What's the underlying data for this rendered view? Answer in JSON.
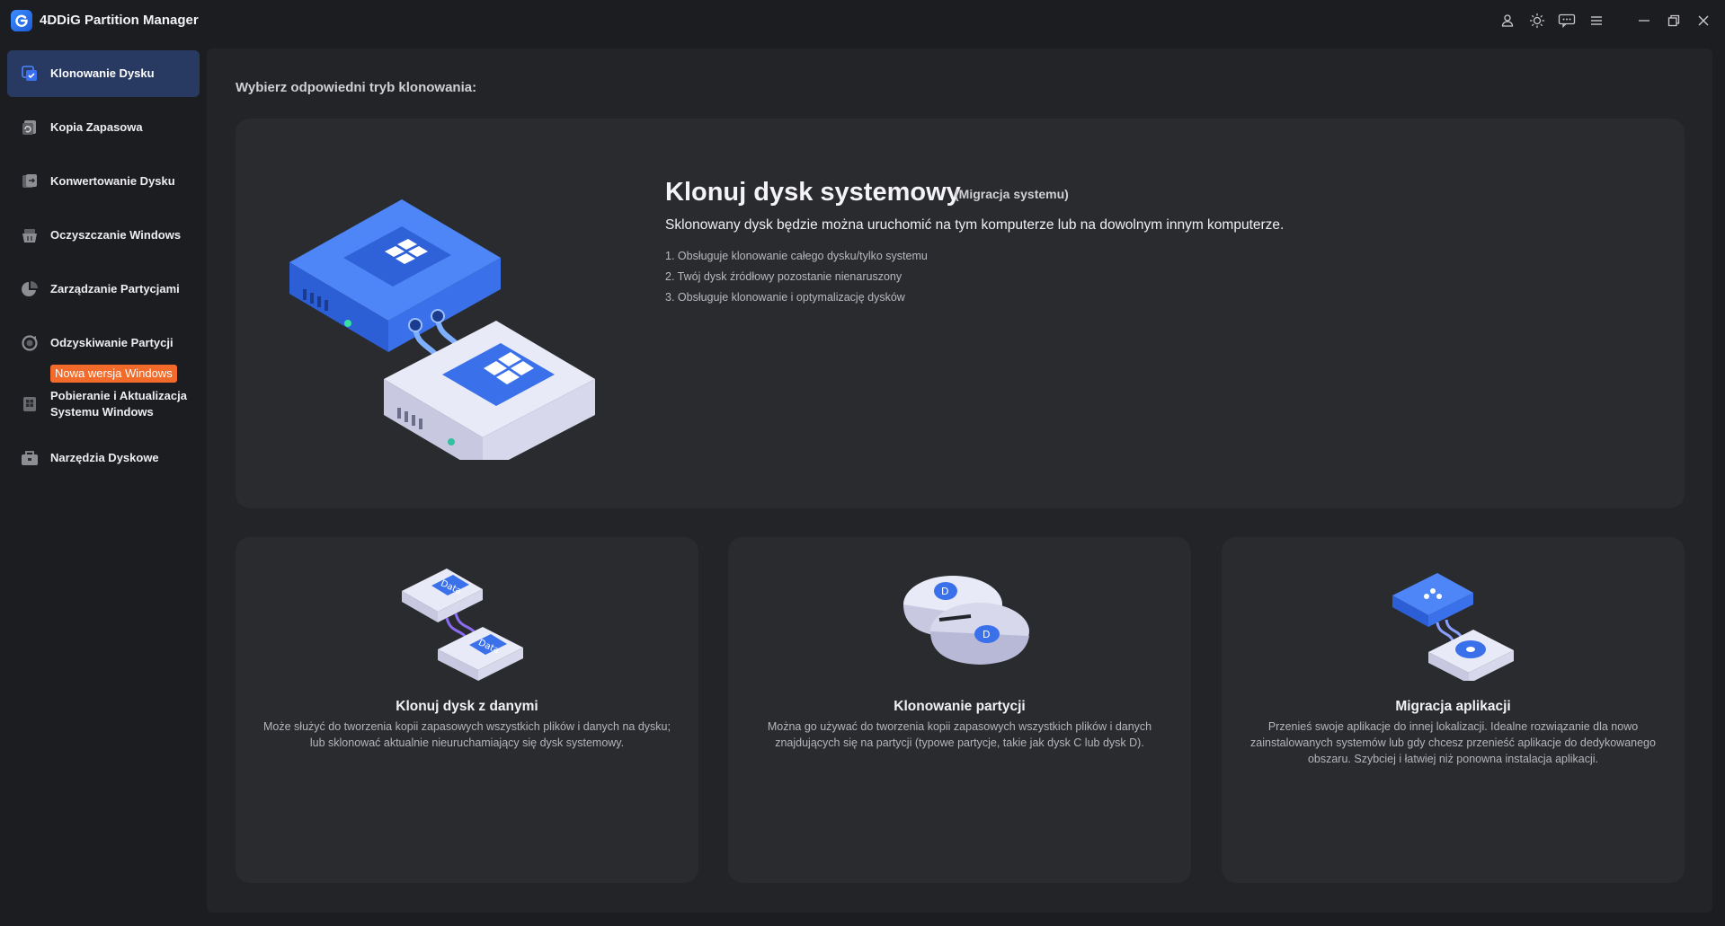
{
  "app": {
    "title": "4DDiG Partition Manager"
  },
  "titlebar": {
    "icons": [
      "user-icon",
      "theme-sun-icon",
      "feedback-icon",
      "menu-icon",
      "minimize-icon",
      "restore-icon",
      "close-icon"
    ]
  },
  "sidebar": {
    "items": [
      {
        "label": "Klonowanie Dysku",
        "icon": "clone-disk-icon",
        "active": true
      },
      {
        "label": "Kopia Zapasowa",
        "icon": "backup-icon"
      },
      {
        "label": "Konwertowanie Dysku",
        "icon": "convert-disk-icon"
      },
      {
        "label": "Oczyszczanie Windows",
        "icon": "clean-windows-icon"
      },
      {
        "label": "Zarządzanie Partycjami",
        "icon": "partition-pie-icon"
      },
      {
        "label": "Odzyskiwanie Partycji",
        "icon": "recovery-icon"
      },
      {
        "label": "Pobieranie i Aktualizacja Systemu Windows",
        "icon": "download-windows-icon"
      },
      {
        "label": "Narzędzia Dyskowe",
        "icon": "toolbox-icon"
      }
    ],
    "badge": "Nowa wersja Windows"
  },
  "main": {
    "heading": "Wybierz odpowiedni tryb klonowania:",
    "big_card": {
      "title": "Klonuj dysk systemowy",
      "subtitle": "(Migracja systemu)",
      "description": "Sklonowany dysk będzie można uruchomić na tym komputerze lub na dowolnym innym komputerze.",
      "features": [
        "1. Obsługuje klonowanie całego dysku/tylko systemu",
        "2. Twój dysk źródłowy pozostanie nienaruszony",
        "3. Obsługuje klonowanie i optymalizację dysków"
      ]
    },
    "cards": [
      {
        "title": "Klonuj dysk z danymi",
        "description": "Może służyć do tworzenia kopii zapasowych wszystkich plików i danych na dysku; lub sklonować aktualnie nieuruchamiający się dysk systemowy.",
        "illus_label_1": "Data",
        "illus_label_2": "Data"
      },
      {
        "title": "Klonowanie partycji",
        "description": "Można go używać do tworzenia kopii zapasowych wszystkich plików i danych znajdujących się na partycji (typowe partycje, takie jak dysk C lub dysk D).",
        "illus_label_1": "D",
        "illus_label_2": "D"
      },
      {
        "title": "Migracja aplikacji",
        "description": "Przenieś swoje aplikacje do innej lokalizacji. Idealne rozwiązanie dla nowo zainstalowanych systemów lub gdy chcesz przenieść aplikacje do dedykowanego obszaru. Szybciej i łatwiej niż ponowna instalacja aplikacji."
      }
    ]
  },
  "colors": {
    "accent": "#3a6ff0",
    "active_nav_bg": "#283a62",
    "badge": "#f26b2a",
    "card_bg": "#2a2b2f",
    "panel_bg": "#232428",
    "window_bg": "#1c1d21"
  }
}
